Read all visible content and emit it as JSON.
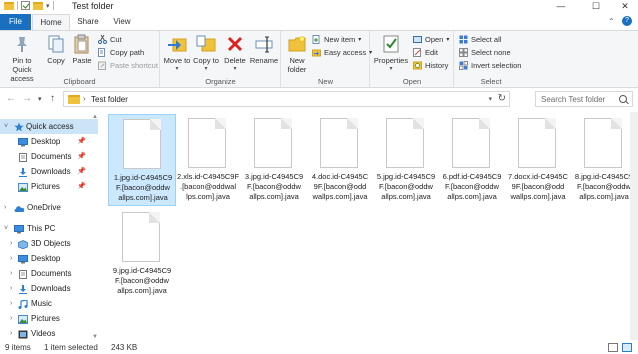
{
  "window": {
    "title": "Test folder"
  },
  "window_controls": {
    "minimize": "—",
    "maximize": "☐",
    "close": "✕"
  },
  "tabs": {
    "file": "File",
    "home": "Home",
    "share": "Share",
    "view": "View"
  },
  "ribbon": {
    "clipboard": {
      "label": "Clipboard",
      "pin": "Pin to Quick access",
      "copy": "Copy",
      "paste": "Paste",
      "cut": "Cut",
      "copy_path": "Copy path",
      "paste_shortcut": "Paste shortcut"
    },
    "organize": {
      "label": "Organize",
      "move_to": "Move to",
      "copy_to": "Copy to",
      "delete": "Delete",
      "rename": "Rename"
    },
    "new": {
      "label": "New",
      "new_folder": "New folder",
      "new_item": "New item",
      "easy_access": "Easy access"
    },
    "open": {
      "label": "Open",
      "properties": "Properties",
      "open": "Open",
      "edit": "Edit",
      "history": "History"
    },
    "select": {
      "label": "Select",
      "select_all": "Select all",
      "select_none": "Select none",
      "invert": "Invert selection"
    }
  },
  "address": {
    "path": "Test folder"
  },
  "search": {
    "placeholder": "Search Test folder"
  },
  "nav": {
    "items": [
      {
        "label": "Quick access",
        "icon": "star-icon"
      },
      {
        "label": "Desktop",
        "icon": "desktop-icon"
      },
      {
        "label": "Documents",
        "icon": "documents-icon"
      },
      {
        "label": "Downloads",
        "icon": "downloads-icon"
      },
      {
        "label": "Pictures",
        "icon": "pictures-icon"
      },
      {
        "label": "OneDrive",
        "icon": "onedrive-icon"
      },
      {
        "label": "This PC",
        "icon": "pc-icon"
      },
      {
        "label": "3D Objects",
        "icon": "3d-objects-icon"
      },
      {
        "label": "Desktop",
        "icon": "desktop-icon"
      },
      {
        "label": "Documents",
        "icon": "documents-icon"
      },
      {
        "label": "Downloads",
        "icon": "downloads-icon"
      },
      {
        "label": "Music",
        "icon": "music-icon"
      },
      {
        "label": "Pictures",
        "icon": "pictures-icon"
      },
      {
        "label": "Videos",
        "icon": "videos-icon"
      }
    ]
  },
  "files": [
    {
      "name": "1.jpg.id-C4945C9F.[bacon@oddwallps.com].java",
      "lines": [
        "1.jpg.id-C4945C9",
        "F.[bacon@oddw",
        "allps.com].java"
      ]
    },
    {
      "name": "2.xls.id-C4945C9F.[bacon@oddwallps.com].java",
      "lines": [
        "2.xls.id-C4945C9F",
        ".[bacon@oddwal",
        "lps.com].java"
      ]
    },
    {
      "name": "3.jpg.id-C4945C9F.[bacon@oddwallps.com].java",
      "lines": [
        "3.jpg.id-C4945C9",
        "F.[bacon@oddw",
        "allps.com].java"
      ]
    },
    {
      "name": "4.doc.id-C4945C9F.[bacon@oddwallps.com].java",
      "lines": [
        "4.doc.id-C4945C",
        "9F.[bacon@odd",
        "wallps.com].java"
      ]
    },
    {
      "name": "5.jpg.id-C4945C9F.[bacon@oddwallps.com].java",
      "lines": [
        "5.jpg.id-C4945C9",
        "F.[bacon@oddw",
        "allps.com].java"
      ]
    },
    {
      "name": "6.pdf.id-C4945C9F.[bacon@oddwallps.com].java",
      "lines": [
        "6.pdf.id-C4945C9",
        "F.[bacon@oddw",
        "allps.com].java"
      ]
    },
    {
      "name": "7.docx.id-C4945C9F.[bacon@oddwallps.com].java",
      "lines": [
        "7.docx.id-C4945C",
        "9F.[bacon@odd",
        "wallps.com].java"
      ]
    },
    {
      "name": "8.jpg.id-C4945C9F.[bacon@oddwallps.com].java",
      "lines": [
        "8.jpg.id-C4945C9",
        "F.[bacon@oddw",
        "allps.com].java"
      ]
    },
    {
      "name": "9.jpg.id-C4945C9F.[bacon@oddwallps.com].java",
      "lines": [
        "9.jpg.id-C4945C9",
        "F.[bacon@oddw",
        "allps.com].java"
      ]
    }
  ],
  "selected_file": "1.jpg.id-C4945C9F.[bacon@oddwallps.com].java",
  "status": {
    "count": "9 items",
    "selection": "1 item selected",
    "size": "243 KB"
  },
  "colors": {
    "accent": "#1a6fc1",
    "selection": "#cce8ff",
    "folder": "#f0c23b"
  }
}
